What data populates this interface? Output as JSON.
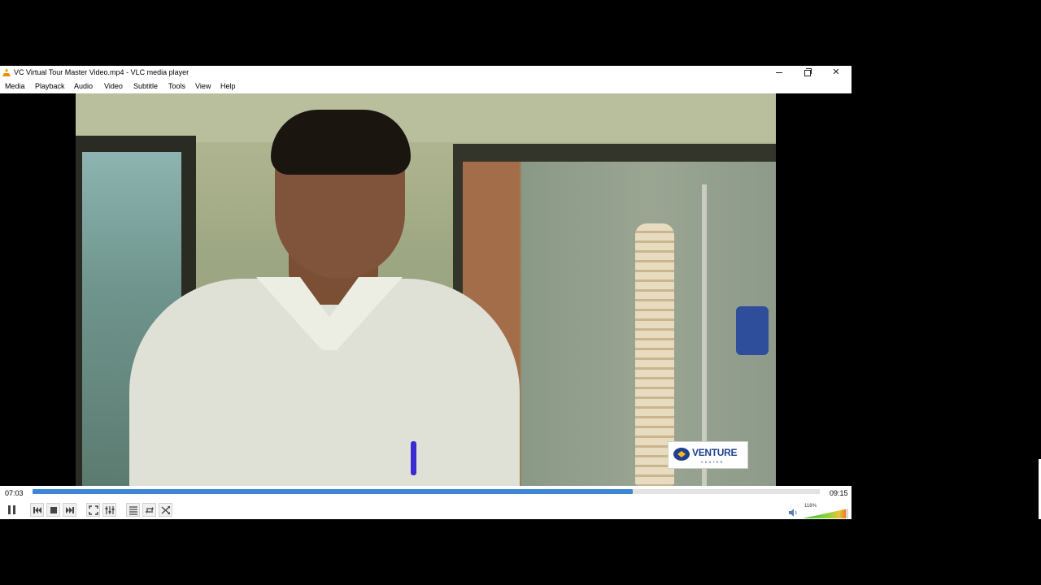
{
  "window": {
    "title": "VC Virtual Tour Master Video.mp4 - VLC media player"
  },
  "menu": {
    "items": [
      "Media",
      "Playback",
      "Audio",
      "Video",
      "Subtitle",
      "Tools",
      "View",
      "Help"
    ]
  },
  "video": {
    "logo_text": "VENTURE",
    "logo_subtext": "CENTER"
  },
  "seek": {
    "elapsed": "07:03",
    "total": "09:15",
    "progress": 0.762
  },
  "controls": {
    "buttons": [
      "pause-icon",
      "previous-icon",
      "stop-icon",
      "next-icon",
      "fullscreen-icon",
      "extended-settings-icon",
      "playlist-icon",
      "loop-icon",
      "shuffle-icon"
    ]
  },
  "volume": {
    "label": "118%",
    "level": 1.18,
    "max": 1.25
  },
  "colors": {
    "seek_fill": "#3d87d6",
    "titlebar_bg": "#ffffff",
    "vlc_orange": "#f08c00"
  }
}
